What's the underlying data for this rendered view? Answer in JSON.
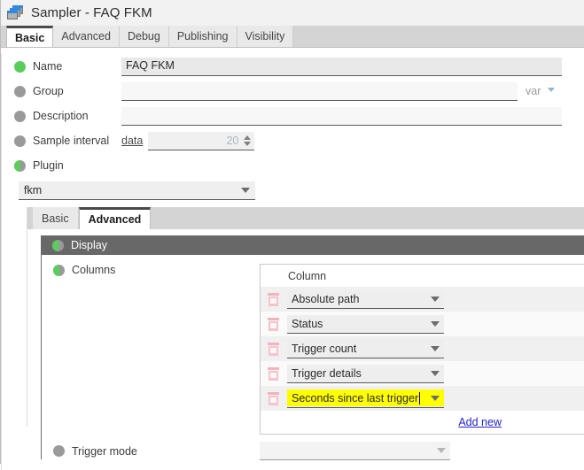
{
  "window": {
    "title": "Sampler - FAQ FKM",
    "icon": "stacked-windows-icon"
  },
  "tabs": [
    {
      "label": "Basic",
      "active": true
    },
    {
      "label": "Advanced",
      "active": false
    },
    {
      "label": "Debug",
      "active": false
    },
    {
      "label": "Publishing",
      "active": false
    },
    {
      "label": "Visibility",
      "active": false
    }
  ],
  "form": {
    "name": {
      "label": "Name",
      "value": "FAQ FKM",
      "placeholder": "",
      "status": "green"
    },
    "group": {
      "label": "Group",
      "value": "",
      "placeholder": "",
      "status": "gray",
      "var_label": "var"
    },
    "description": {
      "label": "Description",
      "value": "",
      "placeholder": "",
      "status": "gray"
    },
    "sample_interval": {
      "label": "Sample interval",
      "data_link": "data",
      "value": "20",
      "status": "gray"
    },
    "plugin": {
      "label": "Plugin",
      "value": "fkm",
      "status": "half"
    }
  },
  "inner_tabs": [
    {
      "label": "Basic",
      "active": false
    },
    {
      "label": "Advanced",
      "active": true
    }
  ],
  "display_section": {
    "title": "Display",
    "status": "half",
    "columns": {
      "label": "Columns",
      "status": "half",
      "table_header": "Column",
      "rows": [
        {
          "value": "Absolute path",
          "highlighted": false
        },
        {
          "value": "Status",
          "highlighted": false
        },
        {
          "value": "Trigger count",
          "highlighted": false
        },
        {
          "value": "Trigger details",
          "highlighted": false
        },
        {
          "value": "Seconds since last trigger",
          "highlighted": true
        }
      ],
      "add_new_label": "Add new"
    }
  },
  "trigger_mode": {
    "label": "Trigger mode",
    "value": "",
    "status": "gray"
  },
  "colors": {
    "accent_green": "#5ccc5c",
    "inactive_gray": "#9a9a9a",
    "highlight_yellow": "#ffff00",
    "link_blue": "#2222cc",
    "section_header_bg": "#686868",
    "delete_icon_pink": "#f7c3cb"
  }
}
